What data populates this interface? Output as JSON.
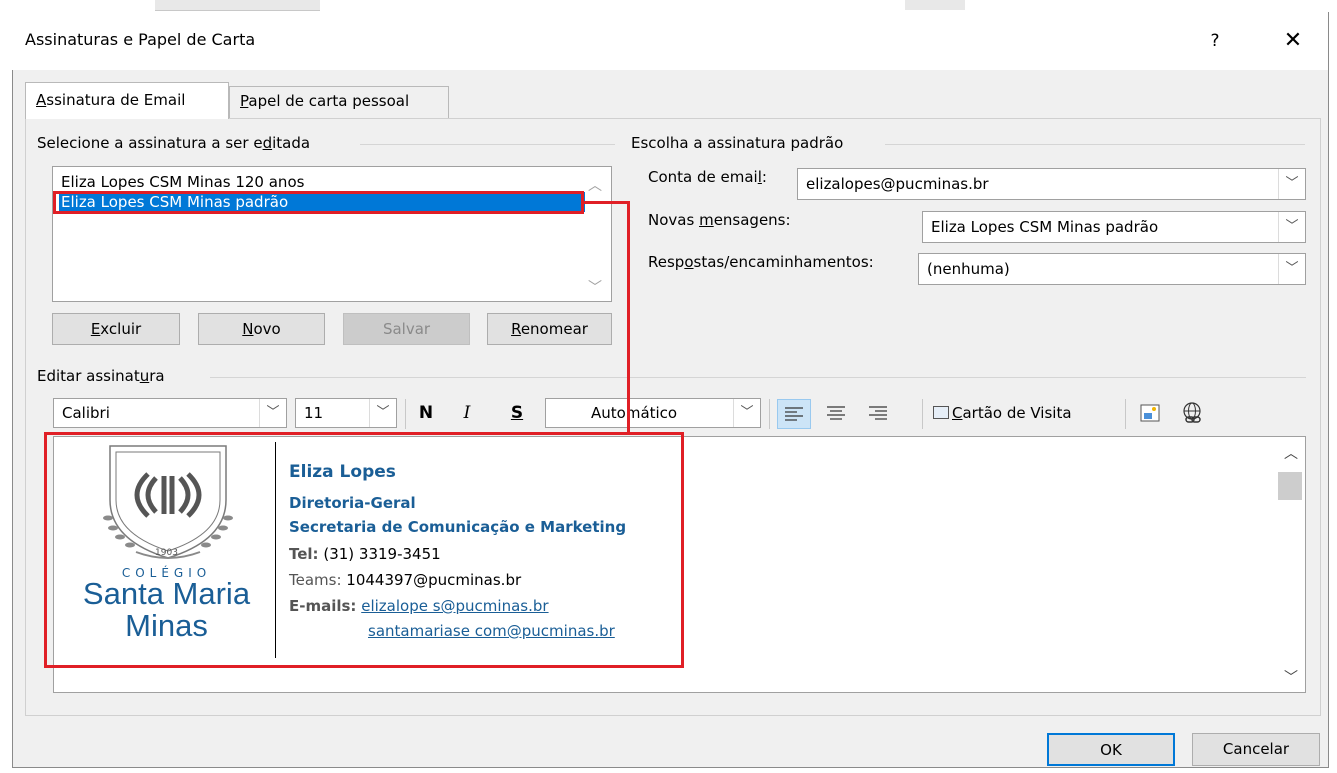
{
  "window": {
    "title": "Assinaturas e Papel de Carta",
    "help_label": "?",
    "close_label": "✕"
  },
  "tabs": [
    {
      "label_pre": "",
      "label_u": "A",
      "label_post": "ssinatura de Email"
    },
    {
      "label_pre": "",
      "label_u": "P",
      "label_post": "apel de carta pessoal"
    }
  ],
  "select_group": {
    "label_pre": "Selecione a assinatura a ser e",
    "label_u": "d",
    "label_post": "itada",
    "items": [
      "Eliza Lopes CSM Minas 120 anos",
      "Eliza Lopes CSM Minas padrão"
    ],
    "selected_index": 1
  },
  "buttons": {
    "delete": {
      "u": "E",
      "rest": "xcluir"
    },
    "new": {
      "u": "N",
      "rest": "ovo"
    },
    "save": "Salvar",
    "rename": {
      "u": "R",
      "rest": "enomear"
    }
  },
  "default_group": {
    "label": "Escolha a assinatura padrão",
    "account_label_pre": "Conta de emai",
    "account_label_u": "l",
    "account_label_post": ":",
    "account_value": "elizalopes@pucminas.br",
    "new_msgs_label_pre": "Novas ",
    "new_msgs_label_u": "m",
    "new_msgs_label_post": "ensagens:",
    "new_msgs_value": "Eliza Lopes CSM Minas padrão",
    "replies_label_pre": "Resp",
    "replies_label_u": "o",
    "replies_label_post": "stas/encaminhamentos:",
    "replies_value": "(nenhuma)"
  },
  "edit_group": {
    "label_pre": "Editar assinat",
    "label_u": "u",
    "label_post": "ra"
  },
  "toolbar": {
    "font": "Calibri",
    "size": "11",
    "bold": "N",
    "italic": "I",
    "underline": "S",
    "color": "Automático",
    "business_card_u": "C",
    "business_card_rest": "artão de Visita"
  },
  "signature": {
    "logo_year": "1903",
    "logo_college": "COLÉGIO",
    "logo_name1": "Santa Maria",
    "logo_name2": "Minas",
    "name": "Eliza Lopes",
    "dept": "Diretoria-Geral",
    "sector": "Secretaria de Comunicação e Marketing",
    "tel_label": "Tel:",
    "tel": "(31) 3319-3451",
    "teams_label": "Teams:",
    "teams": "1044397@pucminas.br",
    "emails_label": "E-mails:",
    "email1": "elizalope s@pucminas.br",
    "email2": "santamariase com@pucminas.br"
  },
  "footer": {
    "ok": "OK",
    "cancel": "Cancelar"
  },
  "colors": {
    "accent": "#0078d7",
    "highlight_red": "#e01f26",
    "brand_blue": "#1a5e96"
  }
}
